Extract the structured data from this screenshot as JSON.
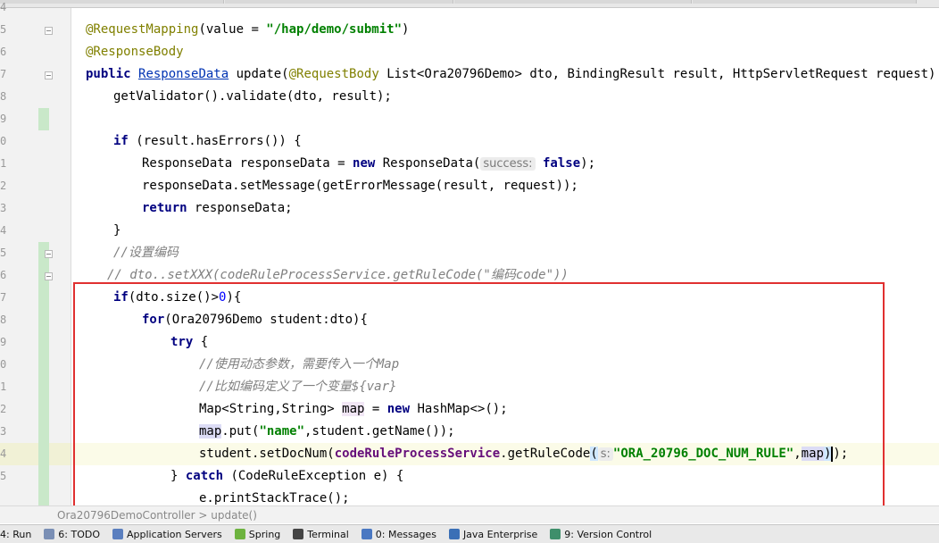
{
  "line_numbers": [
    "4",
    "5",
    "6",
    "7",
    "8",
    "9",
    "0",
    "1",
    "2",
    "3",
    "4",
    "5",
    "6",
    "7",
    "8",
    "9",
    "0",
    "1",
    "2",
    "3",
    "4",
    "5"
  ],
  "code": {
    "l1_ann": "@RequestMapping",
    "l1_mid": "(value = ",
    "l1_str": "\"/hap/demo/submit\"",
    "l1_end": ")",
    "l2_ann": "@ResponseBody",
    "l3_kw": "public ",
    "l3_type": "ResponseData",
    "l3_mid": " update(",
    "l3_ann": "@RequestBody",
    "l3_rest": " List<Ora20796Demo> dto, BindingResult result, HttpServletRequest request) {",
    "l4": "getValidator().validate(dto, result);",
    "l6_kw": "if",
    "l6_rest": " (result.hasErrors()) {",
    "l7_a": "ResponseData responseData = ",
    "l7_kw": "new",
    "l7_b": " ResponseData(",
    "l7_hint": "success:",
    "l7_kw2": "false",
    "l7_c": ");",
    "l8": "responseData.setMessage(getErrorMessage(result, request));",
    "l9_kw": "return",
    "l9_rest": " responseData;",
    "l10": "}",
    "l11_cmt": "//设置编码",
    "l12_cmt": "// dto..setXXX(codeRuleProcessService.getRuleCode(\"编码code\"))",
    "l13_kw": "if",
    "l13_a": "(dto.size()>",
    "l13_num": "0",
    "l13_b": "){",
    "l14_kw": "for",
    "l14_rest": "(Ora20796Demo student:dto){",
    "l15_kw": "try",
    "l15_rest": " {",
    "l16_cmt": "//使用动态参数，需要传入一个Map",
    "l17_cmt": "//比如编码定义了一个变量${var}",
    "l18_a": "Map<String,String> ",
    "l18_var": "map",
    "l18_b": " = ",
    "l18_kw": "new",
    "l18_c": " HashMap<>();",
    "l19_var": "map",
    "l19_a": ".put(",
    "l19_str": "\"name\"",
    "l19_b": ",student.getName());",
    "l20_a": "student.setDocNum(",
    "l20_field": "codeRuleProcessService",
    "l20_b": ".getRuleCode",
    "l20_paren": "(",
    "l20_hint": "s:",
    "l20_str": "\"ORA_20796_DOC_NUM_RULE\"",
    "l20_c": ",",
    "l20_var": "map",
    "l20_paren2": ")",
    "l20_d": ");",
    "l21_a": "} ",
    "l21_kw": "catch",
    "l21_rest": " (CodeRuleException e) {",
    "l22": "e.printStackTrace();"
  },
  "breadcrumb": "Ora20796DemoController  >  update()",
  "toolwindows": [
    {
      "label": "4: Run",
      "icon": "run-icon",
      "color": "#4caf50"
    },
    {
      "label": "6: TODO",
      "icon": "todo-icon",
      "color": "#7a8fb5"
    },
    {
      "label": "Application Servers",
      "icon": "server-icon",
      "color": "#5b7fbf"
    },
    {
      "label": "Spring",
      "icon": "spring-icon",
      "color": "#6db33f"
    },
    {
      "label": "Terminal",
      "icon": "terminal-icon",
      "color": "#444444"
    },
    {
      "label": "0: Messages",
      "icon": "messages-icon",
      "color": "#4a78c2"
    },
    {
      "label": "Java Enterprise",
      "icon": "java-enterprise-icon",
      "color": "#3b6fb6"
    },
    {
      "label": "9: Version Control",
      "icon": "version-control-icon",
      "color": "#3f8f6b"
    }
  ],
  "colors": {
    "highlight_box": "#e03030",
    "caret_line": "#fbfbe8"
  }
}
